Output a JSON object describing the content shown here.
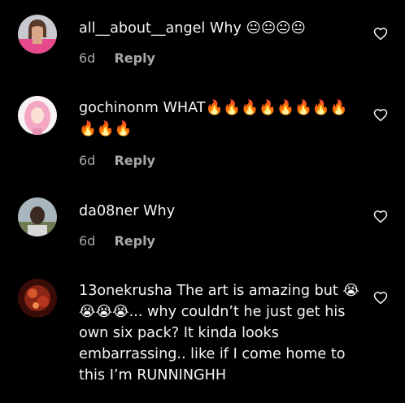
{
  "comments": [
    {
      "username": "all__about__angel",
      "text": "Why 😐😐😐😐",
      "time": "6d",
      "reply_label": "Reply",
      "avatar_icon": "avatar-woman-pink"
    },
    {
      "username": "gochinonm",
      "text": "WHAT🔥🔥🔥🔥🔥🔥🔥🔥🔥🔥🔥",
      "time": "6d",
      "reply_label": "Reply",
      "avatar_icon": "avatar-pink-hair"
    },
    {
      "username": "da08ner",
      "text": "Why",
      "time": "6d",
      "reply_label": "Reply",
      "avatar_icon": "avatar-man-outdoor"
    },
    {
      "username": "13onekrusha",
      "text": "The art is amazing but 😭😭😭😭... why couldn’t he just get his own six pack? It kinda looks embarrassing.. like if I come home to this I’m RUNNINGHH",
      "time": "",
      "reply_label": "",
      "avatar_icon": "avatar-red-fractal"
    }
  ],
  "icons": {
    "like": "heart-outline-icon"
  },
  "colors": {
    "background": "#000000",
    "text": "#f5f5f5",
    "secondary": "#a8a8a8"
  }
}
